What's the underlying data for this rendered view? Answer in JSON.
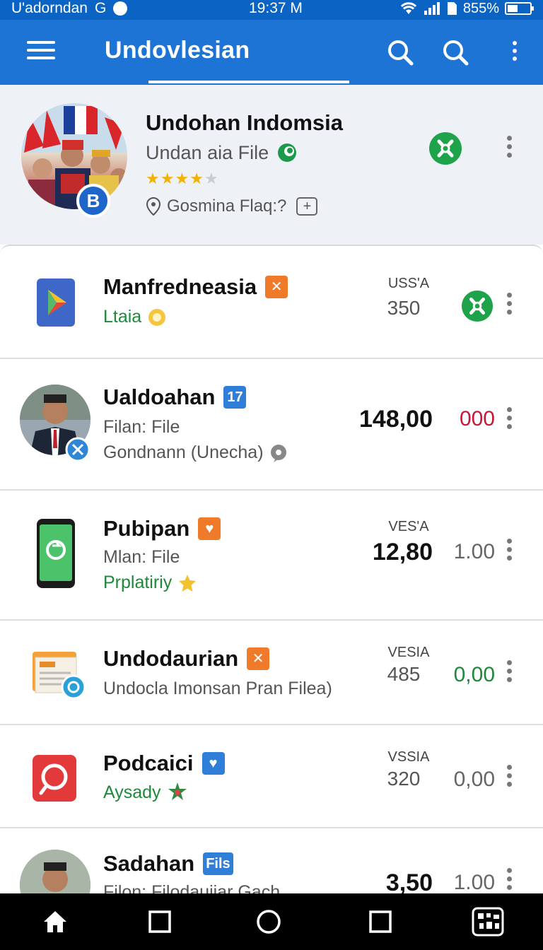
{
  "status_bar": {
    "carrier": "U'adorndan",
    "network_glyph": "G",
    "time": "19:37 M",
    "battery_percent": "855%",
    "icons": [
      "wifi-icon",
      "signal-icon",
      "sim-icon",
      "battery-icon"
    ]
  },
  "app_bar": {
    "title": "Undovlesian",
    "icons": [
      "menu-icon",
      "search-icon",
      "search-icon",
      "more-vert-icon"
    ]
  },
  "featured": {
    "title": "Undohan Indomsia",
    "subtitle": "Undan aia File",
    "rating_stars": 4,
    "rating_max": 5,
    "meta": "Gosmina Flaq:?",
    "badge_letter": "B"
  },
  "list": [
    {
      "name": "Manfredneasia",
      "tag": "✕",
      "tag_color": "#ee7a2a",
      "line2": "Ltaia",
      "line2_green": true,
      "label": "USS'A",
      "value": "350",
      "action": "share-green"
    },
    {
      "name": "Ualdoahan",
      "tag": "17",
      "tag_color": "#2f7fd9",
      "line2": "Filan: File",
      "line3": "Gondnann (Unecha)",
      "big": "148,00",
      "second": "000",
      "second_color": "#c3183a"
    },
    {
      "name": "Pubipan",
      "tag": "♥",
      "tag_color": "#ee7a2a",
      "line2": "Mlan: File",
      "line3": "Prplatiriy",
      "line3_green": true,
      "label": "VES'A",
      "big": "12,80",
      "second": "1.00",
      "second_color": "#666666"
    },
    {
      "name": "Undodaurian",
      "tag": "✕",
      "tag_color": "#ee7a2a",
      "line2": "Undocla Imonsan Pran Filea)",
      "label": "VESIA",
      "value": "485",
      "second": "0,00",
      "second_color": "#1d8a3a"
    },
    {
      "name": "Podcaici",
      "tag": "♥",
      "tag_color": "#2f7fd9",
      "line2": "Aysady",
      "line2_green": true,
      "label": "VSSIA",
      "value": "320",
      "second": "0,00",
      "second_color": "#666666"
    },
    {
      "name": "Sadahan",
      "tag": "Fils",
      "tag_color": "#2f7fd9",
      "line2": "Filon: Filodauijar Gach",
      "big": "3,50",
      "second": "1.00",
      "second_color": "#666666"
    }
  ],
  "nav_bar": {
    "icons": [
      "home-icon",
      "recents-square-icon",
      "home-circle-icon",
      "overview-square-icon",
      "app-launcher-icon"
    ]
  }
}
